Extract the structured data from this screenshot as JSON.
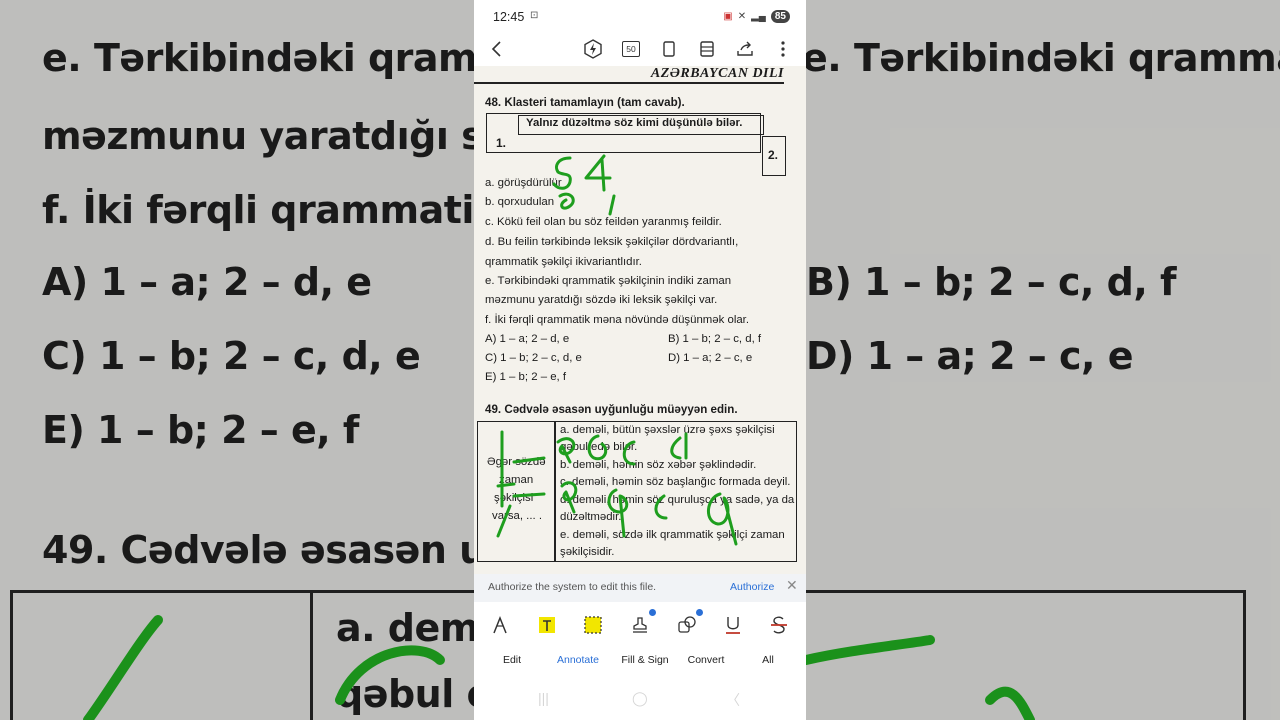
{
  "status_bar": {
    "time": "12:45",
    "battery": "85"
  },
  "toolbar": {
    "back_icon": "chevron-left-icon",
    "zoom_badge": "50",
    "icons": [
      "lightning-icon",
      "page-icon",
      "layout-icon",
      "share-icon",
      "more-icon"
    ]
  },
  "document": {
    "subject": "AZƏRBAYCAN DILI",
    "q48": {
      "title": "48. Klasteri tamamlayın (tam cavab).",
      "cluster_center": "Yalnız düzəltmə söz kimi düşünülə bilər.",
      "label_1": "1.",
      "label_2": "2.",
      "items": [
        "a. görüşdürülür",
        "b. qorxudulan",
        "c. Kökü feil olan bu söz feildən yaranmış feildir.",
        "d. Bu feilin tərkibində leksik şəkilçilər dördvariantlı,",
        "qrammatik şəkilçi ikivariantlıdır.",
        "e. Tərkibindəki qrammatik şəkilçinin indiki zaman",
        "məzmunu yaratdığı sözdə iki leksik şəkilçi var.",
        "f. İki fərqli qrammatik məna növündə düşünmək olar."
      ],
      "options": {
        "A": "A) 1 – a; 2 – d, e",
        "B": "B) 1 – b; 2 – c, d, f",
        "C": "C) 1 – b; 2 – c, d, e",
        "D": "D) 1 – a; 2 – c, e",
        "E": "E) 1 – b; 2 – e, f"
      }
    },
    "q49": {
      "title": "49. Cədvələ əsasən uyğunluğu müəyyən edin.",
      "left_cell": [
        "Əgər sözdə",
        "zaman",
        "şəkilçisi",
        "varsa, ... ."
      ],
      "right_cell": [
        "a. deməli, bütün şəxslər üzrə şəxs şəkilçisi",
        "qəbul edə bilər.",
        "b. deməli, həmin söz xəbər şəklindədir.",
        "c. deməli, həmin söz başlanğıc formada deyil.",
        "d. deməli, həmin söz quruluşca ya sadə, ya da",
        "düzəltmədir.",
        "e. deməli, sözdə ilk qrammatik şəkilçi zaman",
        "şəkilçisidir."
      ]
    }
  },
  "background_zoom": {
    "lines": [
      "e. Tərkibindəki qrammatik şəkilçinin indiki zaman",
      "məzmunu yaratdığı sözdə iki leksik şəkilçi var.",
      "f. İki fərqli qrammatik məna növündə düşünmək olar.",
      "A) 1 – a; 2 – d, e",
      "B) 1 – b; 2 – c, d, f",
      "C) 1 – b; 2 – c, d, e",
      "D) 1 – a; 2 – c, e",
      "E) 1 – b; 2 – e, f",
      "49. Cədvələ əsasən uyğunluğu müəyyən edin.",
      "a. deməli, bütün şəxslər üzrə şəxs şəkilçisi",
      "qəbul e"
    ]
  },
  "authorize_bar": {
    "message": "Authorize the system to edit this file.",
    "action": "Authorize"
  },
  "bottom_tools": {
    "icons": [
      "pen-icon",
      "text-highlight-icon",
      "area-highlight-icon",
      "stamp-icon",
      "shapes-icon",
      "underline-icon",
      "strikethrough-icon"
    ]
  },
  "tabs": [
    {
      "label": "Edit"
    },
    {
      "label": "Annotate"
    },
    {
      "label": "Fill & Sign"
    },
    {
      "label": "Convert"
    },
    {
      "label": "All"
    }
  ],
  "colors": {
    "accent": "#2a6fd6",
    "ink": "#1e9e1e",
    "highlight_yellow": "#f2e600"
  }
}
